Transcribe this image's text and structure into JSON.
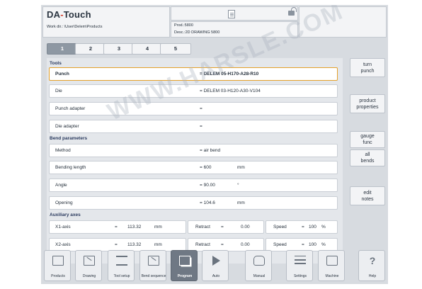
{
  "app": {
    "logo_prefix": "DA",
    "logo_dot": "-",
    "logo_suffix": "Touch",
    "workdir": "Work dir.: \\User\\Delem\\Products",
    "prod": "Prod.:5800",
    "desc": "Desc.:2D DRAWING 5800"
  },
  "tabs": [
    "1",
    "2",
    "3",
    "4",
    "5"
  ],
  "tools": {
    "title": "Tools",
    "rows": [
      {
        "label": "Punch",
        "value": "=  DELEM 05-H170-A28-R10"
      },
      {
        "label": "Die",
        "value": "=  DELEM 03-H120-A30-V104"
      },
      {
        "label": "Punch adapter",
        "value": "="
      },
      {
        "label": "Die adapter",
        "value": "="
      }
    ]
  },
  "bend": {
    "title": "Bend parameters",
    "rows": [
      {
        "label": "Method",
        "value": "=  air bend",
        "unit": ""
      },
      {
        "label": "Bending length",
        "value": "=       600",
        "unit": "mm"
      },
      {
        "label": "Angle",
        "value": "=       90.00",
        "unit": "°"
      },
      {
        "label": "Opening",
        "value": "=       104.6",
        "unit": "mm"
      }
    ]
  },
  "aux": {
    "title": "Auxiliary axes",
    "rows": [
      {
        "label": "X1-axis",
        "eq": "=",
        "value": "113.32",
        "unit": "mm",
        "retract_label": "Retract",
        "retract_eq": "=",
        "retract_value": "0.00",
        "speed_label": "Speed",
        "speed_eq": "=",
        "speed_value": "100",
        "speed_unit": "%"
      },
      {
        "label": "X2-axis",
        "eq": "=",
        "value": "113.32",
        "unit": "mm",
        "retract_label": "Retract",
        "retract_eq": "=",
        "retract_value": "0.00",
        "speed_label": "Speed",
        "speed_eq": "=",
        "speed_value": "100",
        "speed_unit": "%"
      }
    ]
  },
  "watermark": "WWW.HARSLE.COM",
  "side_buttons": [
    {
      "line1": "turn",
      "line2": "punch"
    },
    {
      "line1": "product",
      "line2": "properties"
    },
    {
      "line1": "gauge",
      "line2": "func"
    },
    {
      "line1": "all",
      "line2": "bends"
    },
    {
      "line1": "edit",
      "line2": "notes"
    }
  ],
  "toolbar": [
    {
      "label": "Products",
      "icon": "folder-icon"
    },
    {
      "label": "Drawing",
      "icon": "drawing-icon"
    },
    {
      "label": "Tool setup",
      "icon": "tool-setup-icon"
    },
    {
      "label": "Bend sequence",
      "icon": "bend-sequence-icon"
    },
    {
      "label": "Program",
      "icon": "program-icon"
    },
    {
      "label": "Auto",
      "icon": "play-icon"
    },
    {
      "label": "Manual",
      "icon": "hand-icon"
    },
    {
      "label": "Settings",
      "icon": "settings-icon"
    },
    {
      "label": "Machine",
      "icon": "machine-icon"
    },
    {
      "label": "Help",
      "icon": "help-icon"
    }
  ],
  "colors": {
    "active_row_border": "#e3a02a",
    "section_title": "#2a3a5e",
    "logo_dot": "#d23c2a",
    "active_tab": "#8e98a3"
  }
}
